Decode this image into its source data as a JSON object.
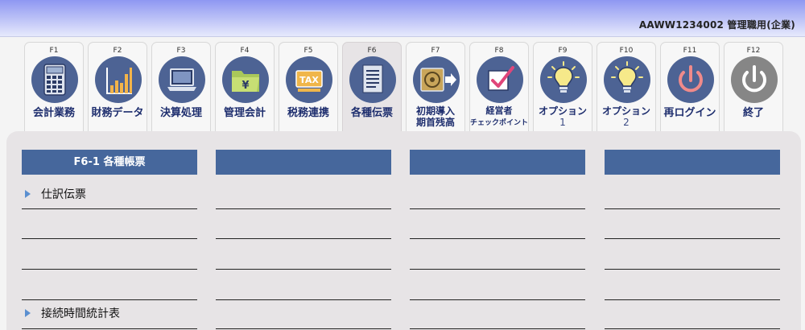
{
  "header": {
    "user_label": "AAWW1234002 管理職用(企業)"
  },
  "tabs": [
    {
      "key": "F1",
      "label": "会計業務",
      "icon": "calculator-icon"
    },
    {
      "key": "F2",
      "label": "財務データ",
      "icon": "bar-chart-icon"
    },
    {
      "key": "F3",
      "label": "決算処理",
      "icon": "laptop-icon"
    },
    {
      "key": "F4",
      "label": "管理会計",
      "icon": "yen-folder-icon"
    },
    {
      "key": "F5",
      "label": "税務連携",
      "icon": "tax-icon"
    },
    {
      "key": "F6",
      "label": "各種伝票",
      "icon": "document-icon",
      "active": true
    },
    {
      "key": "F7",
      "label_line1": "初期導入",
      "label_line2": "期首残高",
      "icon": "disc-export-icon"
    },
    {
      "key": "F8",
      "label_line1": "経営者",
      "label_line2": "チェックポイント",
      "icon": "checkbox-icon"
    },
    {
      "key": "F9",
      "label_line1": "オプション",
      "label_line2": "1",
      "icon": "lightbulb-icon"
    },
    {
      "key": "F10",
      "label_line1": "オプション",
      "label_line2": "2",
      "icon": "lightbulb-icon"
    },
    {
      "key": "F11",
      "label": "再ログイン",
      "icon": "power-icon"
    },
    {
      "key": "F12",
      "label": "終了",
      "icon": "power-icon"
    }
  ],
  "panel": {
    "columns": [
      {
        "title": "F6-1 各種帳票"
      },
      {
        "title": ""
      },
      {
        "title": ""
      },
      {
        "title": ""
      }
    ],
    "items": [
      {
        "label": "仕訳伝票"
      },
      {
        "label": "接続時間統計表"
      }
    ]
  },
  "colors": {
    "accent": "#46679c",
    "icon_circle": "#4d6394",
    "icon_circle_exit": "#868686",
    "tab_label": "#1e2e6e",
    "panel_bg": "#e7e4e6"
  }
}
